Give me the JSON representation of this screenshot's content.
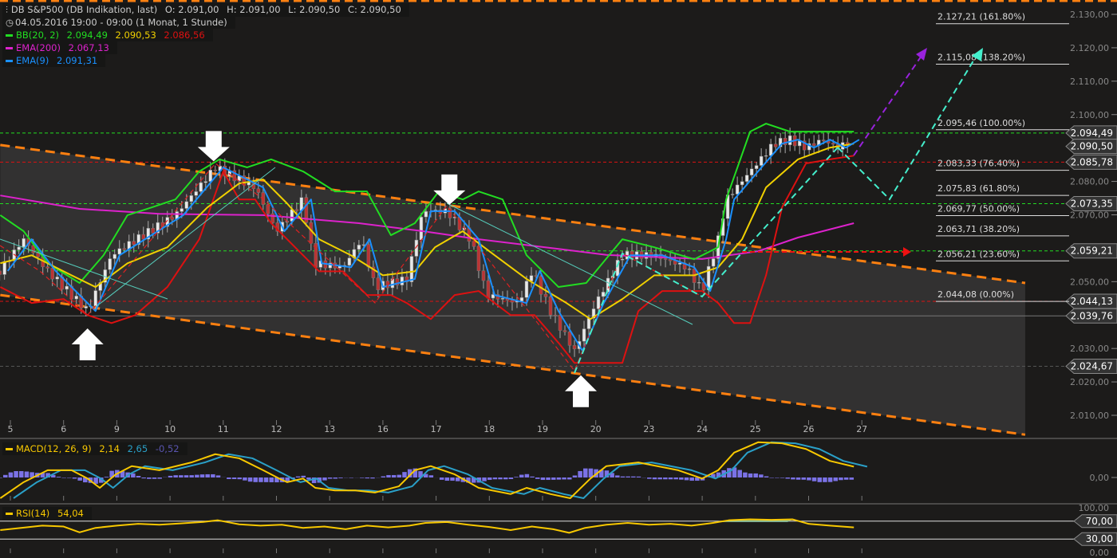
{
  "header": {
    "title": "DB S&P500 (DB Indikation, last)",
    "ohlc": {
      "open": "O: 2.091,00",
      "high": "H: 2.091,00",
      "low": "L: 2.090,50",
      "close": "C: 2.090,50"
    },
    "period": "04.05.2016 19:00 - 09:00 (1 Monat, 1 Stunde)"
  },
  "indicators": {
    "bb": {
      "label": "BB(20, 2)",
      "upper": "2.094,49",
      "middle": "2.090,53",
      "lower": "2.086,56"
    },
    "ema200": {
      "label": "EMA(200)",
      "value": "2.067,13"
    },
    "ema9": {
      "label": "EMA(9)",
      "value": "2.091,31"
    },
    "macd": {
      "label": "MACD(12, 26, 9)",
      "macd": "2,14",
      "signal": "2,65",
      "hist": "-0,52"
    },
    "rsi": {
      "label": "RSI(14)",
      "value": "54,04"
    }
  },
  "colors": {
    "bb_upper": "#22dd22",
    "bb_middle": "#f0d000",
    "bb_lower": "#dd1111",
    "ema200": "#dd22cc",
    "ema9": "#1a90ff",
    "channel": "#ff8010",
    "macd": "#f8c800",
    "signal": "#2aa0c8",
    "hist": "#7b72e6",
    "rsi": "#f8c800"
  },
  "chart_data": {
    "type": "line",
    "title": "DB S&P500 (DB Indikation, last)",
    "x_tick_labels": [
      "5",
      "6",
      "9",
      "10",
      "11",
      "12",
      "13",
      "16",
      "17",
      "18",
      "19",
      "20",
      "23",
      "24",
      "25",
      "26",
      "27"
    ],
    "y_ticks": [
      "2.130,00",
      "2.120,00",
      "2.110,00",
      "2.100,00",
      "2.090,00",
      "2.080,00",
      "2.070,00",
      "2.060,00",
      "2.050,00",
      "2.040,00",
      "2.030,00",
      "2.020,00",
      "2.010,00"
    ],
    "ylim": [
      2010,
      2130
    ],
    "close": {
      "x": [
        -0.2,
        0.25,
        0.7,
        1.45,
        1.9,
        2.5,
        3.1,
        3.85,
        4.6,
        5.0,
        5.5,
        5.7,
        6.25,
        6.6,
        6.85,
        7.45,
        7.75,
        8.2,
        8.65,
        8.95,
        9.55,
        9.8,
        10.15,
        10.6,
        11.0,
        11.5,
        12.1,
        12.7,
        13.0,
        13.3,
        13.45,
        13.9,
        14.35,
        14.65,
        14.95,
        15.25,
        15.55,
        15.8
      ],
      "y": [
        2053.2,
        2062.7,
        2053.2,
        2041.2,
        2057.9,
        2063.9,
        2069.9,
        2084.2,
        2078.2,
        2065.1,
        2074.6,
        2055.5,
        2054.3,
        2062.7,
        2048.4,
        2050.8,
        2071.1,
        2071.1,
        2062.7,
        2046.0,
        2043.6,
        2053.2,
        2041.2,
        2029.3,
        2043.6,
        2057.9,
        2057.9,
        2054.3,
        2047.2,
        2062.7,
        2074.6,
        2083.0,
        2091.3,
        2092.5,
        2090.1,
        2092.5,
        2090.1,
        2092.5
      ]
    },
    "bb_upper": {
      "x": [
        -0.19,
        0.25,
        0.7,
        1.3,
        1.75,
        2.2,
        2.65,
        3.1,
        3.55,
        3.93,
        4.45,
        4.9,
        5.5,
        6.1,
        6.7,
        7.15,
        7.6,
        8.05,
        8.5,
        8.8,
        9.25,
        9.7,
        10.3,
        10.82,
        11.5,
        12.1,
        12.85,
        13.3,
        13.45,
        13.9,
        14.2,
        14.65,
        15.25,
        15.85
      ],
      "y": [
        2069.9,
        2065.1,
        2055.5,
        2049.6,
        2057.9,
        2069.9,
        2072.2,
        2074.6,
        2083.0,
        2086.6,
        2084.2,
        2086.6,
        2083.0,
        2077.0,
        2077.0,
        2063.9,
        2067.5,
        2077.0,
        2074.6,
        2077.0,
        2074.6,
        2057.9,
        2048.4,
        2049.6,
        2062.7,
        2060.3,
        2056.7,
        2060.3,
        2074.6,
        2094.9,
        2097.3,
        2094.9,
        2094.9,
        2094.9
      ]
    },
    "bb_middle": {
      "x": [
        -0.19,
        0.4,
        1.15,
        1.6,
        2.2,
        2.95,
        3.7,
        4.3,
        4.75,
        5.2,
        5.8,
        6.4,
        7.0,
        7.6,
        7.98,
        8.5,
        9.1,
        9.7,
        10.45,
        10.9,
        11.5,
        12.1,
        12.85,
        13.3,
        13.75,
        14.2,
        14.8,
        15.4,
        15.85
      ],
      "y": [
        2055.5,
        2057.9,
        2051.9,
        2048.4,
        2055.5,
        2060.3,
        2072.2,
        2079.4,
        2080.6,
        2073.4,
        2062.7,
        2057.9,
        2051.9,
        2053.1,
        2060.3,
        2065.1,
        2057.9,
        2050.8,
        2043.6,
        2038.8,
        2044.8,
        2051.9,
        2051.9,
        2054.3,
        2062.7,
        2078.2,
        2086.6,
        2090.1,
        2091.3
      ]
    },
    "bb_lower": {
      "x": [
        -0.19,
        0.4,
        1.0,
        1.45,
        1.9,
        2.35,
        2.95,
        3.55,
        4.0,
        4.3,
        4.6,
        4.9,
        5.35,
        5.8,
        6.25,
        6.7,
        7.15,
        7.45,
        7.9,
        8.35,
        8.8,
        9.4,
        9.85,
        10.3,
        10.6,
        11.2,
        11.5,
        11.8,
        12.25,
        13.0,
        13.3,
        13.6,
        13.9,
        14.2,
        14.5,
        14.95,
        15.4,
        15.85
      ],
      "y": [
        2048.4,
        2043.6,
        2044.8,
        2040.0,
        2037.6,
        2040.0,
        2048.4,
        2062.7,
        2083.0,
        2074.6,
        2074.6,
        2067.5,
        2060.3,
        2053.1,
        2053.1,
        2046.0,
        2046.0,
        2043.6,
        2038.8,
        2046.0,
        2047.2,
        2040.0,
        2040.0,
        2031.7,
        2025.7,
        2025.7,
        2025.7,
        2041.2,
        2047.2,
        2047.2,
        2043.6,
        2037.6,
        2037.6,
        2051.9,
        2072.2,
        2085.4,
        2086.6,
        2087.7
      ]
    },
    "ema200": {
      "x": [
        -0.19,
        1.3,
        2.8,
        4.75,
        6.55,
        7.75,
        8.8,
        10.3,
        11.2,
        13.0,
        14.05,
        14.8,
        15.85
      ],
      "y": [
        2075.8,
        2071.8,
        2070.3,
        2069.9,
        2067.5,
        2065.1,
        2062.7,
        2059.8,
        2058.0,
        2056.8,
        2059.1,
        2063.2,
        2067.5
      ]
    },
    "channel": {
      "upper": {
        "x": [
          -0.19,
          19.07
        ],
        "y": [
          2090.9,
          2049.6
        ]
      },
      "lower": {
        "x": [
          -0.19,
          19.07
        ],
        "y": [
          2046.0,
          2004.2
        ]
      }
    },
    "fibonacci": [
      {
        "price": 2127.21,
        "label": "2.127,21 (161.80%)"
      },
      {
        "price": 2115.08,
        "label": "2.115,08 (138.20%)"
      },
      {
        "price": 2095.46,
        "label": "2.095,46 (100.00%)"
      },
      {
        "price": 2083.33,
        "label": "2.083,33 (76.40%)"
      },
      {
        "price": 2075.83,
        "label": "2.075,83 (61.80%)"
      },
      {
        "price": 2069.77,
        "label": "2.069,77 (50.00%)"
      },
      {
        "price": 2063.71,
        "label": "2.063,71 (38.20%)"
      },
      {
        "price": 2056.21,
        "label": "2.056,21 (23.60%)"
      },
      {
        "price": 2044.08,
        "label": "2.044,08 (0.00%)"
      }
    ],
    "price_tags": [
      {
        "price": 2094.49,
        "label": "2.094,49",
        "line": "#22dd22"
      },
      {
        "price": 2090.5,
        "label": "2.090,50",
        "line": ""
      },
      {
        "price": 2085.78,
        "label": "2.085,78",
        "line": "#dd1111"
      },
      {
        "price": 2073.35,
        "label": "2.073,35",
        "line": "#22dd22"
      },
      {
        "price": 2059.21,
        "label": "2.059,21",
        "line": "#22dd22"
      },
      {
        "price": 2044.13,
        "label": "2.044,13",
        "line": "#dd1111"
      },
      {
        "price": 2039.76,
        "label": "2.039,76",
        "line": "#777777"
      },
      {
        "price": 2024.67,
        "label": "2.024,67",
        "line": "#555555"
      }
    ],
    "arrows": [
      {
        "dir": "down",
        "x": 3.82,
        "price": 2086
      },
      {
        "dir": "down",
        "x": 8.25,
        "price": 2073
      },
      {
        "dir": "up",
        "x": 1.45,
        "price": 2036
      },
      {
        "dir": "up",
        "x": 10.72,
        "price": 2022
      }
    ],
    "macd": {
      "x": [
        -0.19,
        0.25,
        0.7,
        1.15,
        1.45,
        1.68,
        1.98,
        2.28,
        2.8,
        3.4,
        3.85,
        4.3,
        4.75,
        5.05,
        5.2,
        5.5,
        5.73,
        6.1,
        6.48,
        6.85,
        7.3,
        7.6,
        7.9,
        8.35,
        8.8,
        9.4,
        9.7,
        10.15,
        10.52,
        10.9,
        11.2,
        11.8,
        12.55,
        13.0,
        13.3,
        13.6,
        14.05,
        14.5,
        14.95,
        15.4,
        15.85
      ],
      "y": [
        -4.0,
        -0.9,
        1.4,
        1.4,
        -0.2,
        -2.0,
        0.6,
        2.2,
        1.4,
        2.9,
        4.5,
        3.7,
        1.4,
        -0.2,
        -0.9,
        -0.2,
        -2.0,
        -2.5,
        -2.5,
        -2.9,
        -1.7,
        1.4,
        2.2,
        0.6,
        -2.0,
        -3.2,
        -2.0,
        -3.2,
        -4.0,
        -0.2,
        2.2,
        2.9,
        1.4,
        -0.2,
        1.4,
        4.8,
        6.8,
        6.6,
        5.5,
        3.2,
        2.1
      ],
      "zero_label": "0,00"
    },
    "rsi": {
      "x": [
        -0.19,
        0.2,
        0.6,
        1.0,
        1.3,
        1.6,
        2.0,
        2.4,
        2.8,
        3.2,
        3.6,
        3.9,
        4.3,
        4.7,
        5.1,
        5.5,
        5.9,
        6.3,
        6.7,
        7.1,
        7.5,
        7.8,
        8.2,
        8.6,
        9.0,
        9.4,
        9.8,
        10.2,
        10.5,
        10.8,
        11.2,
        11.6,
        12.0,
        12.4,
        12.8,
        13.2,
        13.5,
        13.9,
        14.3,
        14.7,
        15.0,
        15.4,
        15.85
      ],
      "y": [
        50,
        55,
        60,
        58,
        45,
        55,
        60,
        64,
        62,
        65,
        68,
        72,
        63,
        60,
        62,
        55,
        58,
        52,
        60,
        56,
        60,
        66,
        68,
        62,
        57,
        50,
        58,
        52,
        44,
        55,
        62,
        66,
        62,
        64,
        60,
        66,
        72,
        74,
        73,
        74,
        64,
        60,
        56
      ],
      "levels": [
        {
          "v": 100,
          "label": "100,00",
          "tag": false
        },
        {
          "v": 70,
          "label": "70,00",
          "tag": true
        },
        {
          "v": 30,
          "label": "30,00",
          "tag": true
        },
        {
          "v": 0,
          "label": "0,00",
          "tag": false
        }
      ]
    }
  }
}
